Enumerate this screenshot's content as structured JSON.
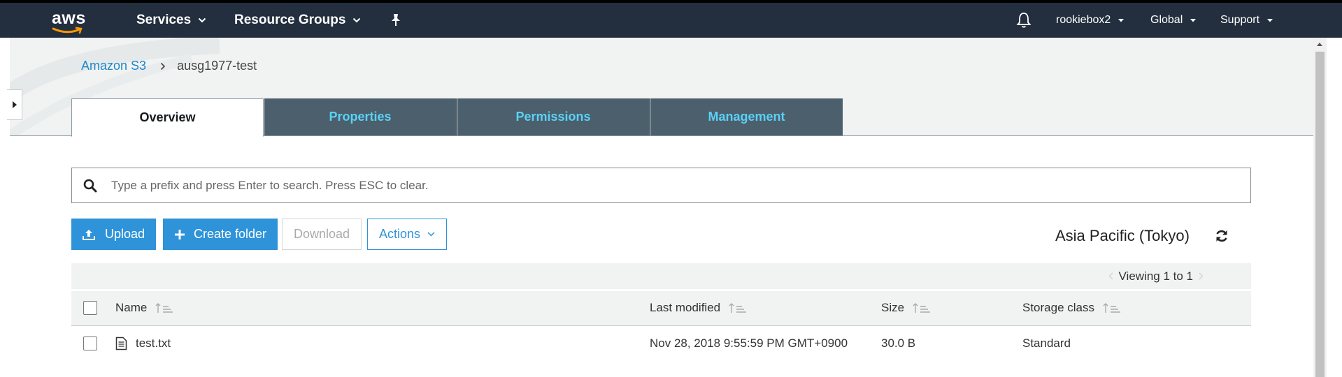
{
  "topbar": {
    "logo_text": "aws",
    "services_label": "Services",
    "resource_groups_label": "Resource Groups",
    "account_label": "rookiebox2",
    "region_menu_label": "Global",
    "support_label": "Support"
  },
  "breadcrumb": {
    "root": "Amazon S3",
    "current": "ausg1977-test"
  },
  "tabs": [
    {
      "label": "Overview",
      "active": true
    },
    {
      "label": "Properties",
      "active": false
    },
    {
      "label": "Permissions",
      "active": false
    },
    {
      "label": "Management",
      "active": false
    }
  ],
  "search": {
    "placeholder": "Type a prefix and press Enter to search. Press ESC to clear.",
    "value": ""
  },
  "toolbar": {
    "upload_label": "Upload",
    "create_folder_label": "Create folder",
    "download_label": "Download",
    "actions_label": "Actions"
  },
  "region_label": "Asia Pacific (Tokyo)",
  "viewing_label": "Viewing 1 to 1",
  "table": {
    "columns": [
      "Name",
      "Last modified",
      "Size",
      "Storage class"
    ],
    "rows": [
      {
        "name": "test.txt",
        "last_modified": "Nov 28, 2018 9:55:59 PM GMT+0900",
        "size": "30.0 B",
        "storage_class": "Standard"
      }
    ]
  },
  "colors": {
    "navbar": "#232f3e",
    "accent": "#2e93d8",
    "tab_inactive_bg": "#4b5f6d",
    "tab_inactive_text": "#5bd1f5"
  }
}
